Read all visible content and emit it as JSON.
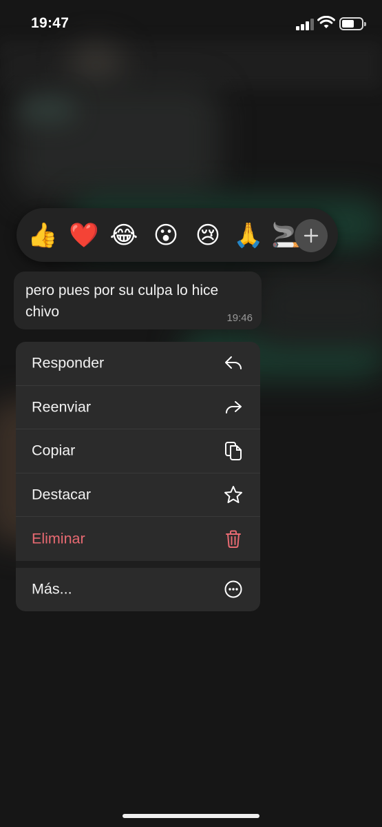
{
  "status_bar": {
    "time": "19:47"
  },
  "reactions": {
    "emojis": [
      "👍",
      "❤️",
      "😂",
      "😮",
      "😢",
      "🙏",
      "🚬"
    ],
    "add_label": "+"
  },
  "message": {
    "text": "pero pues por su culpa lo hice chivo",
    "time": "19:46"
  },
  "menu": {
    "items": [
      {
        "label": "Responder",
        "icon": "reply-icon"
      },
      {
        "label": "Reenviar",
        "icon": "forward-icon"
      },
      {
        "label": "Copiar",
        "icon": "copy-icon"
      },
      {
        "label": "Destacar",
        "icon": "star-icon"
      },
      {
        "label": "Eliminar",
        "icon": "trash-icon",
        "color": "#e86a72"
      }
    ],
    "more": {
      "label": "Más...",
      "icon": "more-icon"
    }
  },
  "colors": {
    "danger": "#e86a72",
    "accent_green": "#1f4a3a"
  }
}
